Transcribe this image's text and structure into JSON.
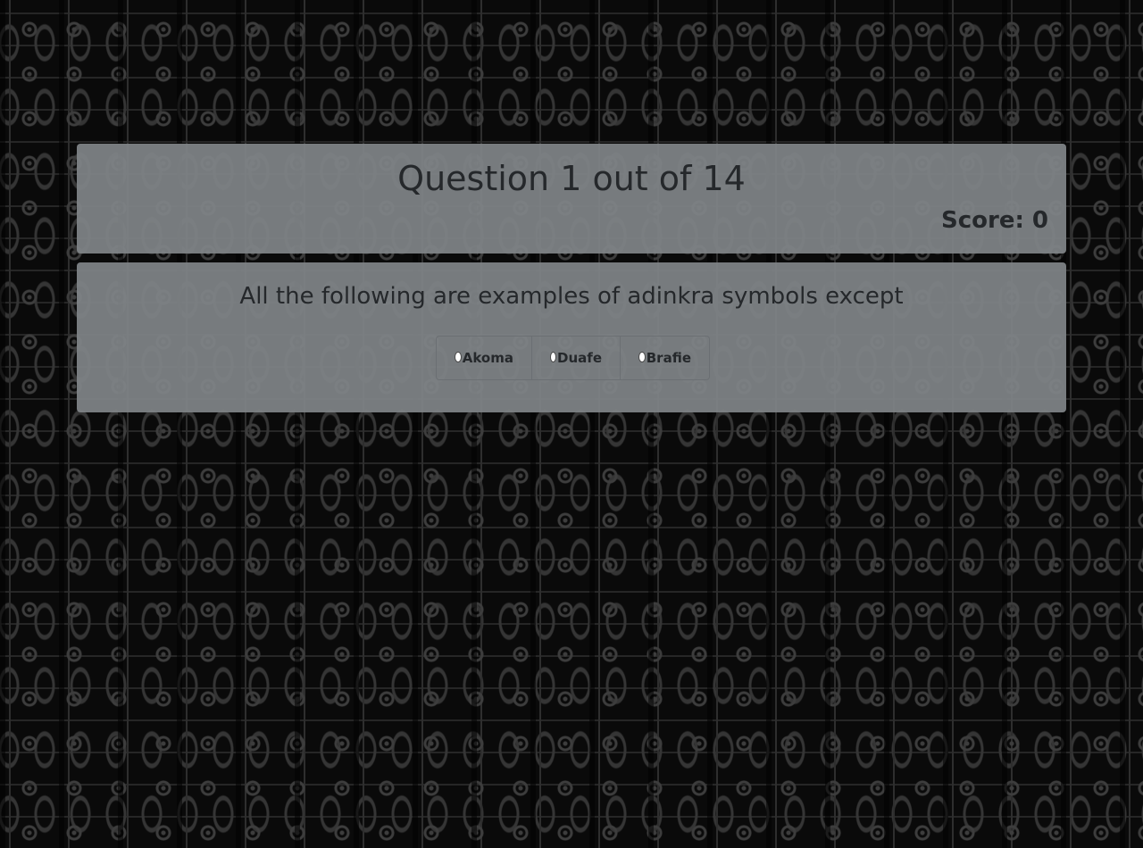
{
  "quiz": {
    "question_counter": "Question 1 out of 14",
    "score_text": "Score: 0",
    "question_text": "All the following are examples of adinkra symbols except",
    "options": [
      {
        "label": "Akoma",
        "selected": false
      },
      {
        "label": "Duafe",
        "selected": false
      },
      {
        "label": "Brafie",
        "selected": false
      }
    ]
  },
  "colors": {
    "card_background": "#808488",
    "text": "#25282b",
    "page_background": "#0a0a0a",
    "pattern": "#3d3d3d"
  }
}
